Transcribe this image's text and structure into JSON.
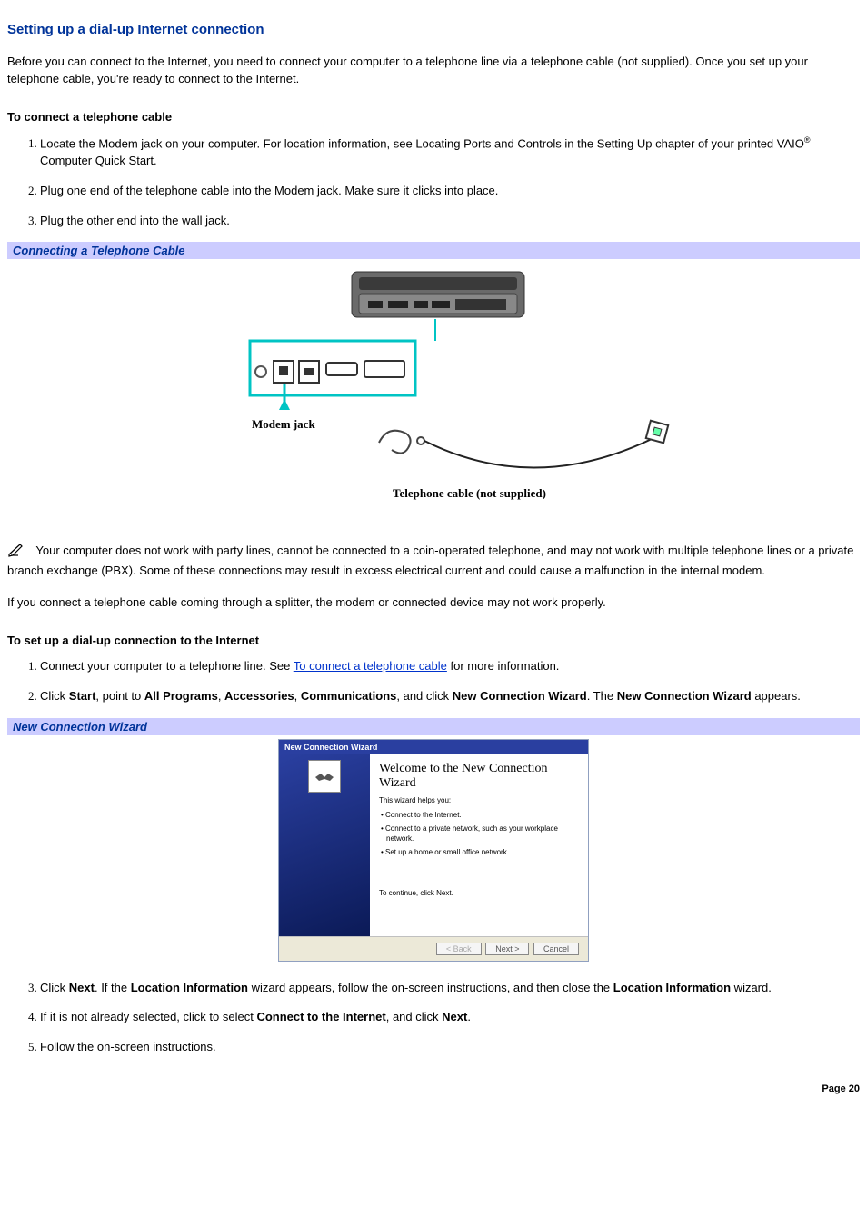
{
  "page": {
    "title": "Setting up a dial-up Internet connection",
    "intro": "Before you can connect to the Internet, you need to connect your computer to a telephone line via a telephone cable (not supplied). Once you set up your telephone cable, you're ready to connect to the Internet.",
    "page_number": "Page 20"
  },
  "section_a": {
    "heading": "To connect a telephone cable",
    "step1_a": "Locate the Modem jack on your computer. For location information, see Locating Ports and Controls in the Setting Up chapter of your printed VAIO",
    "step1_reg": "®",
    "step1_b": " Computer Quick Start.",
    "step2": "Plug one end of the telephone cable into the Modem jack. Make sure it clicks into place.",
    "step3": "Plug the other end into the wall jack."
  },
  "figure1": {
    "caption": "Connecting a Telephone Cable",
    "label_modem": "Modem jack",
    "label_cable": "Telephone cable (not supplied)"
  },
  "note": {
    "text": "Your computer does not work with party lines, cannot be connected to a coin-operated telephone, and may not work with multiple telephone lines or a private branch exchange (PBX). Some of these connections may result in excess electrical current and could cause a malfunction in the internal modem.",
    "splitter_text": "If you connect a telephone cable coming through a splitter, the modem or connected device may not work properly."
  },
  "section_b": {
    "heading": "To set up a dial-up connection to the Internet",
    "step1_a": "Connect your computer to a telephone line. See ",
    "step1_link": "To connect a telephone cable",
    "step1_b": " for more information.",
    "step2_a": "Click ",
    "step2_start": "Start",
    "step2_b": ", point to ",
    "step2_allprograms": "All Programs",
    "step2_c": ", ",
    "step2_accessories": "Accessories",
    "step2_d": ", ",
    "step2_communications": "Communications",
    "step2_e": ", and click ",
    "step2_wizard": "New Connection Wizard",
    "step2_f": ". The ",
    "step2_wizard2": "New Connection Wizard",
    "step2_g": " appears.",
    "step3_a": "Click ",
    "step3_next": "Next",
    "step3_b": ". If the ",
    "step3_loc1": "Location Information",
    "step3_c": " wizard appears, follow the on-screen instructions, and then close the ",
    "step3_loc2": "Location Information",
    "step3_d": " wizard.",
    "step4_a": "If it is not already selected, click to select ",
    "step4_connect": "Connect to the Internet",
    "step4_b": ", and click ",
    "step4_next": "Next",
    "step4_c": ".",
    "step5": "Follow the on-screen instructions."
  },
  "figure2": {
    "caption": "New Connection Wizard",
    "title": "New Connection Wizard",
    "heading": "Welcome to the New Connection Wizard",
    "sub": "This wizard helps you:",
    "b1": "• Connect to the Internet.",
    "b2": "• Connect to a private network, such as your workplace network.",
    "b3": "• Set up a home or small office network.",
    "continue": "To continue, click Next.",
    "btn_back": "< Back",
    "btn_next": "Next >",
    "btn_cancel": "Cancel"
  }
}
